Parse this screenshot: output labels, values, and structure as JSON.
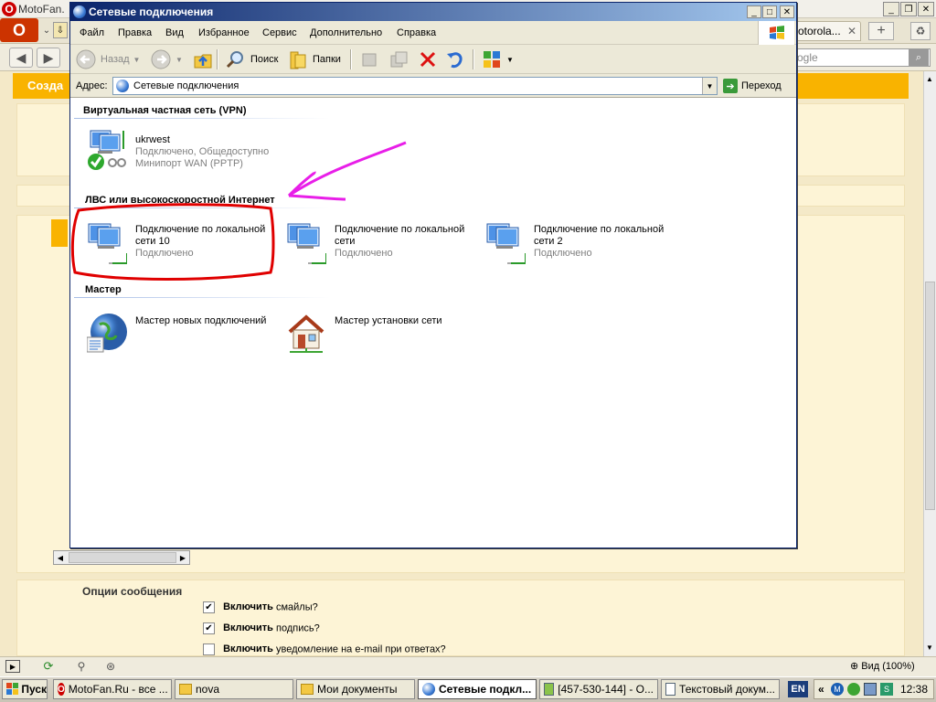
{
  "opera": {
    "title": "MotoFan.",
    "tab_motorola": "otorola...",
    "search_placeholder": "ogle",
    "orange_bar_text": "Созда",
    "message_options_title": "Опции сообщения",
    "options": [
      {
        "bold": "Включить",
        "rest": "смайлы?",
        "checked": true
      },
      {
        "bold": "Включить",
        "rest": "подпись?",
        "checked": true
      },
      {
        "bold": "Включить",
        "rest": "уведомление на e-mail при ответах?",
        "checked": false
      }
    ],
    "zoom_label": "Вид (100%)"
  },
  "explorer": {
    "title": "Сетевые подключения",
    "menu": [
      "Файл",
      "Правка",
      "Вид",
      "Избранное",
      "Сервис",
      "Дополнительно",
      "Справка"
    ],
    "toolbar": {
      "back": "Назад",
      "search": "Поиск",
      "folders": "Папки"
    },
    "address_label": "Адрес:",
    "address_value": "Сетевые подключения",
    "go_label": "Переход",
    "groups": {
      "vpn": "Виртуальная частная сеть (VPN)",
      "lan": "ЛВС или высокоскоростной Интернет",
      "wizard": "Мастер"
    },
    "vpn_item": {
      "name": "ukrwest",
      "status": "Подключено, Общедоступно",
      "device": "Минипорт WAN (PPTP)"
    },
    "lan_items": [
      {
        "name1": "Подключение по локальной",
        "name2": "сети 10",
        "status": "Подключено"
      },
      {
        "name1": "Подключение по локальной",
        "name2": "сети",
        "status": "Подключено"
      },
      {
        "name1": "Подключение по локальной",
        "name2": "сети 2",
        "status": "Подключено"
      }
    ],
    "wizard_items": [
      "Мастер новых подключений",
      "Мастер установки сети"
    ]
  },
  "taskbar": {
    "start": "Пуск",
    "tasks": [
      "MotoFan.Ru - все ...",
      "nova",
      "Мои документы",
      "Сетевые подкл...",
      "[457-530-144] - О...",
      "Текстовый докум..."
    ],
    "lang": "EN",
    "clock": "12:38"
  },
  "colors": {
    "annotation_red": "#e00000",
    "annotation_magenta": "#e81ee8",
    "title_blue": "#0a246a"
  }
}
